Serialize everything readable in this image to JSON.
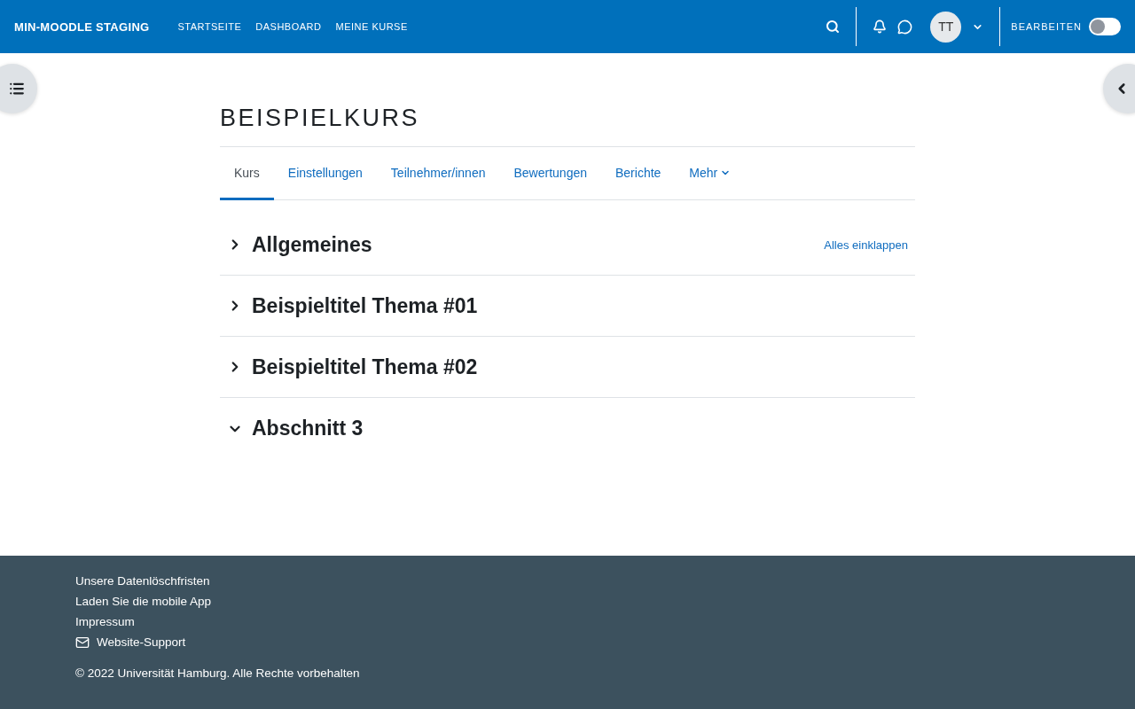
{
  "navbar": {
    "brand": "MIN-MOODLE STAGING",
    "links": [
      "STARTSEITE",
      "DASHBOARD",
      "MEINE KURSE"
    ],
    "avatar": "TT",
    "edit_mode": {
      "label": "BEARBEITEN",
      "on": false
    }
  },
  "course": {
    "title": "BEISPIELKURS",
    "tabs": [
      {
        "label": "Kurs",
        "selected": true,
        "dropdown": false
      },
      {
        "label": "Einstellungen",
        "selected": false,
        "dropdown": false
      },
      {
        "label": "Teilnehmer/innen",
        "selected": false,
        "dropdown": false
      },
      {
        "label": "Bewertungen",
        "selected": false,
        "dropdown": false
      },
      {
        "label": "Berichte",
        "selected": false,
        "dropdown": false
      },
      {
        "label": "Mehr",
        "selected": false,
        "dropdown": true
      }
    ],
    "collapse_all": "Alles einklappen",
    "sections": [
      {
        "title": "Allgemeines",
        "expanded": false
      },
      {
        "title": "Beispieltitel Thema #01",
        "expanded": false
      },
      {
        "title": "Beispieltitel Thema #02",
        "expanded": false
      },
      {
        "title": "Abschnitt 3",
        "expanded": true
      }
    ]
  },
  "footer": {
    "links": [
      {
        "label": "Unsere Datenlöschfristen",
        "kind": "link"
      },
      {
        "label": "Laden Sie die mobile App",
        "kind": "link"
      },
      {
        "label": "Impressum",
        "kind": "link"
      },
      {
        "label": "Website-Support",
        "kind": "mail"
      }
    ],
    "copyright": "© 2022 Universität Hamburg. Alle Rechte vorbehalten"
  }
}
